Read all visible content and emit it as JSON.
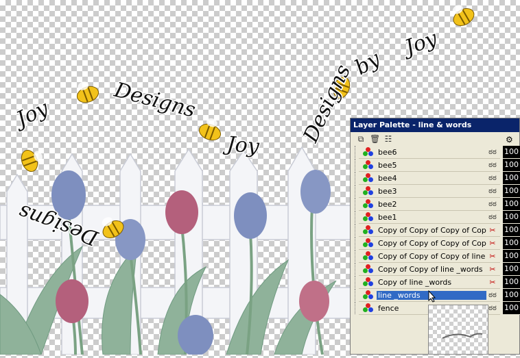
{
  "palette": {
    "title": "Layer Palette - line & words",
    "toolbar_icons": [
      "new-layer-icon",
      "delete-layer-icon",
      "layer-properties-icon"
    ],
    "layers": [
      {
        "name": "bee6",
        "visible": true
      },
      {
        "name": "bee5",
        "visible": true
      },
      {
        "name": "bee4",
        "visible": true
      },
      {
        "name": "bee3",
        "visible": true
      },
      {
        "name": "bee2",
        "visible": true
      },
      {
        "name": "bee1",
        "visible": true
      },
      {
        "name": "Copy of Copy of Copy of Copy ...",
        "visible": false
      },
      {
        "name": "Copy of Copy of Copy of Copy ...",
        "visible": false
      },
      {
        "name": "Copy of Copy of Copy of line _w...",
        "visible": false
      },
      {
        "name": "Copy of Copy of line _words",
        "visible": false
      },
      {
        "name": "Copy of line _words",
        "visible": false
      },
      {
        "name": "line _words",
        "visible": true,
        "selected": true
      },
      {
        "name": "fence",
        "visible": true
      }
    ],
    "opacity": [
      "100",
      "100",
      "100",
      "100",
      "100",
      "100",
      "100",
      "100",
      "100",
      "100",
      "100",
      "100",
      "100"
    ],
    "visible_glyph": "ಠಠ",
    "hidden_glyph": "✂"
  },
  "canvas_text": {
    "joy1": "Joy",
    "designs1": "Designs",
    "joy2": "Joy",
    "designs_top": "Designs",
    "by": "by",
    "joy3": "Joy",
    "designs_bottom": "Designs"
  },
  "colors": {
    "title_bar": "#0a246a",
    "selection": "#316ac5",
    "tulip_blue": "#7e8fbf",
    "tulip_pink": "#b4607c",
    "leaf": "#8fb29a",
    "bee_yellow": "#f2c21a"
  }
}
